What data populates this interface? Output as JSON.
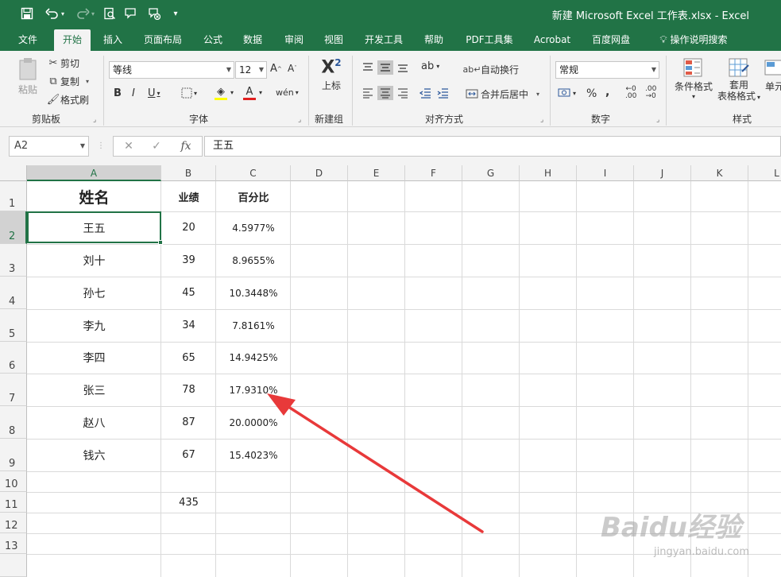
{
  "window": {
    "title": "新建 Microsoft Excel 工作表.xlsx  -  Excel"
  },
  "tabs": [
    "文件",
    "开始",
    "插入",
    "页面布局",
    "公式",
    "数据",
    "审阅",
    "视图",
    "开发工具",
    "帮助",
    "PDF工具集",
    "Acrobat",
    "百度网盘"
  ],
  "active_tab": "开始",
  "tell_me": "操作说明搜索",
  "ribbon": {
    "clipboard": {
      "paste": "粘贴",
      "cut": "剪切",
      "copy": "复制",
      "format_painter": "格式刷",
      "label": "剪贴板"
    },
    "font": {
      "font_name": "等线",
      "font_size": "12",
      "label": "字体"
    },
    "newgroup": {
      "superscript": "上标",
      "label": "新建组"
    },
    "alignment": {
      "wrap_text": "自动换行",
      "merge_center": "合并后居中",
      "label": "对齐方式"
    },
    "number": {
      "format": "常规",
      "label": "数字"
    },
    "styles": {
      "conditional": "条件格式",
      "table_format_1": "套用",
      "table_format_2": "表格格式",
      "cell_styles": "单元",
      "label": "样式"
    }
  },
  "formula_bar": {
    "name_box": "A2",
    "fx": "fx",
    "content": "王五"
  },
  "columns": [
    "A",
    "B",
    "C",
    "D",
    "E",
    "F",
    "G",
    "H",
    "I",
    "J",
    "K",
    "L"
  ],
  "rows": [
    "1",
    "2",
    "3",
    "4",
    "5",
    "6",
    "7",
    "8",
    "9",
    "10",
    "11",
    "12",
    "13"
  ],
  "sheet": {
    "headers": {
      "a": "姓名",
      "b": "业绩",
      "c": "百分比"
    },
    "records": [
      {
        "name": "王五",
        "score": "20",
        "pct": "4.5977%"
      },
      {
        "name": "刘十",
        "score": "39",
        "pct": "8.9655%"
      },
      {
        "name": "孙七",
        "score": "45",
        "pct": "10.3448%"
      },
      {
        "name": "李九",
        "score": "34",
        "pct": "7.8161%"
      },
      {
        "name": "李四",
        "score": "65",
        "pct": "14.9425%"
      },
      {
        "name": "张三",
        "score": "78",
        "pct": "17.9310%"
      },
      {
        "name": "赵八",
        "score": "87",
        "pct": "20.0000%"
      },
      {
        "name": "钱六",
        "score": "67",
        "pct": "15.4023%"
      }
    ],
    "total": "435"
  },
  "watermark": {
    "text": "Baidu经验",
    "url": "jingyan.baidu.com"
  },
  "colors": {
    "brand": "#217346",
    "annotation_arrow": "#e8393a"
  }
}
